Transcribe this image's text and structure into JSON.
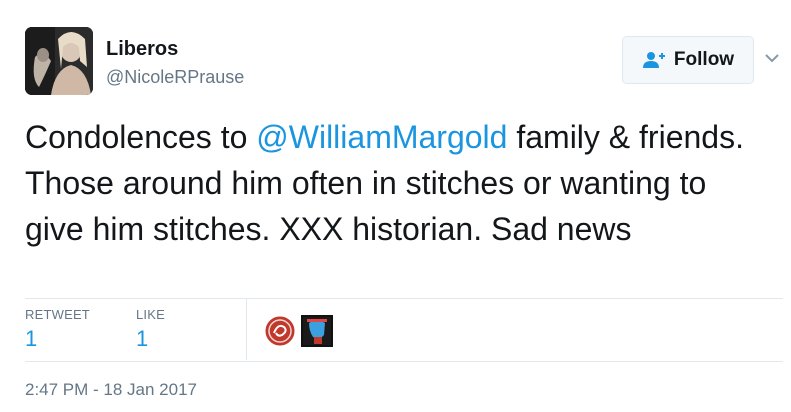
{
  "user": {
    "display_name": "Liberos",
    "handle": "@NicoleRPrause",
    "avatar": "profile-photo"
  },
  "follow_button": {
    "label": "Follow",
    "icon": "add-user-icon"
  },
  "menu": {
    "icon": "chevron-down-icon"
  },
  "tweet": {
    "text_before": "Condolences to ",
    "mention": "@WilliamMargold",
    "text_after": " family & friends. Those around him often in stitches or wanting to give him stitches. XXX historian. Sad news"
  },
  "stats": {
    "retweet_label": "RETWEET",
    "retweet_count": "1",
    "like_label": "LIKE",
    "like_count": "1"
  },
  "likers": [
    "liker-avatar-red-logo",
    "liker-avatar-blue-figure"
  ],
  "timestamp": "2:47 PM - 18 Jan 2017",
  "colors": {
    "link": "#1b95e0",
    "text": "#14171a",
    "muted": "#657786",
    "border": "#e1e8ed"
  }
}
